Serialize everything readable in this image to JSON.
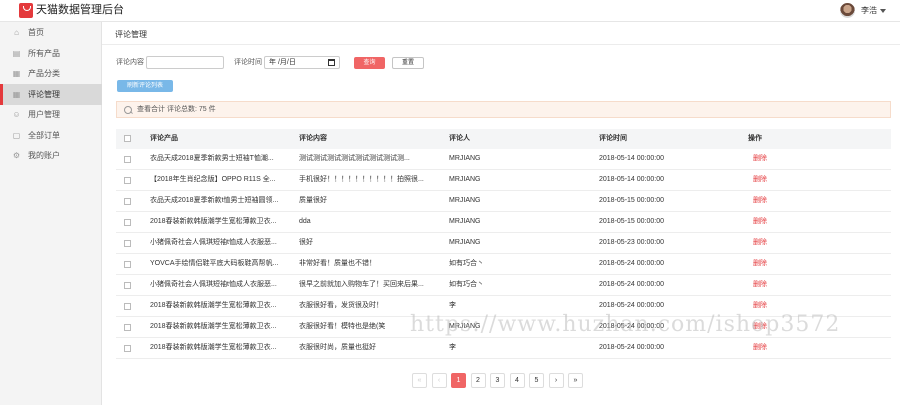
{
  "app": {
    "title": "天猫数据管理后台",
    "brand_color": "#e4393c"
  },
  "user": {
    "name": "李浩",
    "caret_icon": "caret-down-icon"
  },
  "sidebar": {
    "items": [
      {
        "label": "首页",
        "icon": "home-icon",
        "glyph": "⌂"
      },
      {
        "label": "所有产品",
        "icon": "product-icon",
        "glyph": "▤"
      },
      {
        "label": "产品分类",
        "icon": "category-icon",
        "glyph": "▦"
      },
      {
        "label": "评论管理",
        "icon": "grid-icon",
        "glyph": "▦",
        "active": true
      },
      {
        "label": "用户管理",
        "icon": "user-icon",
        "glyph": "☺"
      },
      {
        "label": "全部订单",
        "icon": "order-icon",
        "glyph": "▢"
      },
      {
        "label": "我的账户",
        "icon": "gear-icon",
        "glyph": "⚙"
      }
    ]
  },
  "page": {
    "title": "评论管理"
  },
  "filters": {
    "content_label": "评论内容",
    "content_value": "",
    "time_label": "评论时间",
    "time_placeholder": "年 /月/日",
    "query_label": "查询",
    "reset_label": "重置",
    "refresh_label": "刷新评论列表"
  },
  "summary": {
    "text": "查看合计  评论总数: 75 件"
  },
  "table": {
    "headers": [
      "评论产品",
      "评论内容",
      "评论人",
      "评论时间",
      "操作"
    ],
    "delete_label": "删除",
    "rows": [
      [
        "衣品天成2018夏季新款男士短袖T恤潮...",
        "测试测试测试测试测试测试测试测...",
        "MRJIANG",
        "2018-05-14 00:00:00"
      ],
      [
        "【2018年生肖纪念版】OPPO R11S 全...",
        "手机很好！！！！！！！！！！拍照很...",
        "MRJIANG",
        "2018-05-14 00:00:00"
      ],
      [
        "衣品天成2018夏季新款t恤男士短袖圆领...",
        "质量很好",
        "MRJIANG",
        "2018-05-15 00:00:00"
      ],
      [
        "2018春装新款韩版潮学生宽松薄款卫衣...",
        "dda",
        "MRJIANG",
        "2018-05-15 00:00:00"
      ],
      [
        "小猪佩奇社会人佩琪短袖t恤成人衣服恶...",
        "很好",
        "MRJIANG",
        "2018-05-23 00:00:00"
      ],
      [
        "YOVCA手绘情侣鞋平底大码板鞋高帮帆...",
        "非常好看！质量也不错！",
        "如有巧合丶",
        "2018-05-24 00:00:00"
      ],
      [
        "小猪佩奇社会人佩琪短袖t恤成人衣服恶...",
        "很早之前就加入购物车了！买回来后果...",
        "如有巧合丶",
        "2018-05-24 00:00:00"
      ],
      [
        "2018春装新款韩版潮学生宽松薄款卫衣...",
        "衣服很好看，发货很及时！",
        "李",
        "2018-05-24 00:00:00"
      ],
      [
        "2018春装新款韩版潮学生宽松薄款卫衣...",
        "衣服很好看！模特也是绝(笑",
        "MRJIANG",
        "2018-05-24 00:00:00"
      ],
      [
        "2018春装新款韩版潮学生宽松薄款卫衣...",
        "衣服很时尚，质量也挺好",
        "李",
        "2018-05-24 00:00:00"
      ]
    ]
  },
  "pager": {
    "first": "«",
    "prev": "‹",
    "next": "›",
    "last": "»",
    "pages": [
      "1",
      "2",
      "3",
      "4",
      "5"
    ],
    "current": "1",
    "active_color": "#f06565"
  },
  "watermark": {
    "text": "https://www.huzhan.com/ishop3572"
  }
}
